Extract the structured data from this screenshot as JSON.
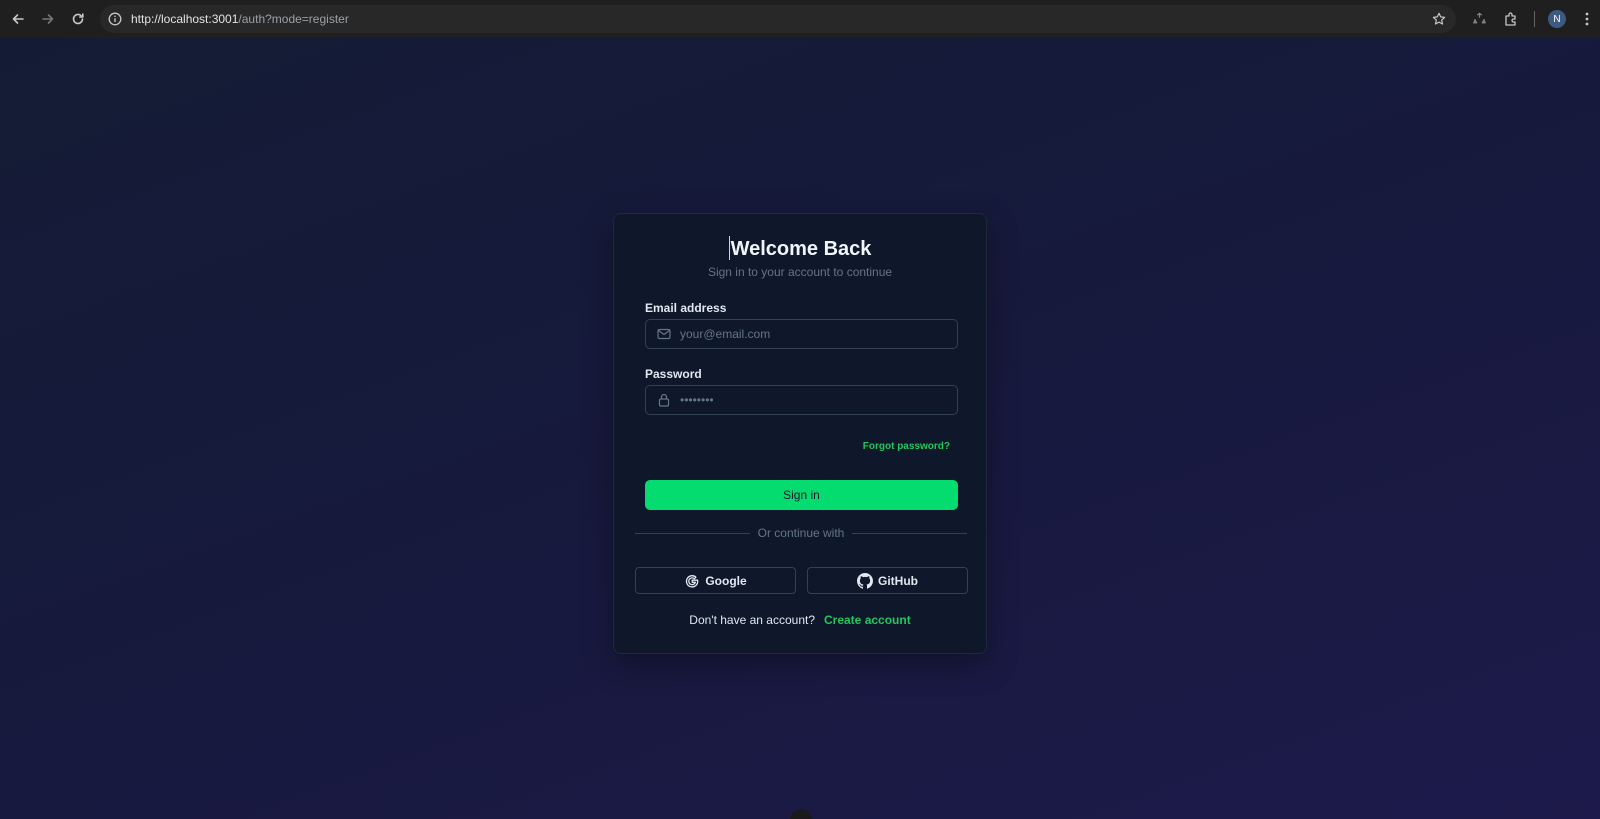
{
  "browser": {
    "url_host": "http://localhost:3001",
    "url_path": "/auth?mode=register",
    "avatar_initial": "N"
  },
  "auth": {
    "title": "Welcome Back",
    "subtitle": "Sign in to your account to continue",
    "email_label": "Email address",
    "email_placeholder": "your@email.com",
    "password_label": "Password",
    "password_placeholder": "••••••••",
    "forgot_label": "Forgot password?",
    "signin_label": "Sign in",
    "divider_text": "Or continue with",
    "google_label": "Google",
    "github_label": "GitHub",
    "no_account_text": "Don't have an account?",
    "create_account_label": "Create account"
  },
  "colors": {
    "accent": "#05dc6f",
    "link": "#22c55e",
    "card_bg": "#0f172a"
  }
}
